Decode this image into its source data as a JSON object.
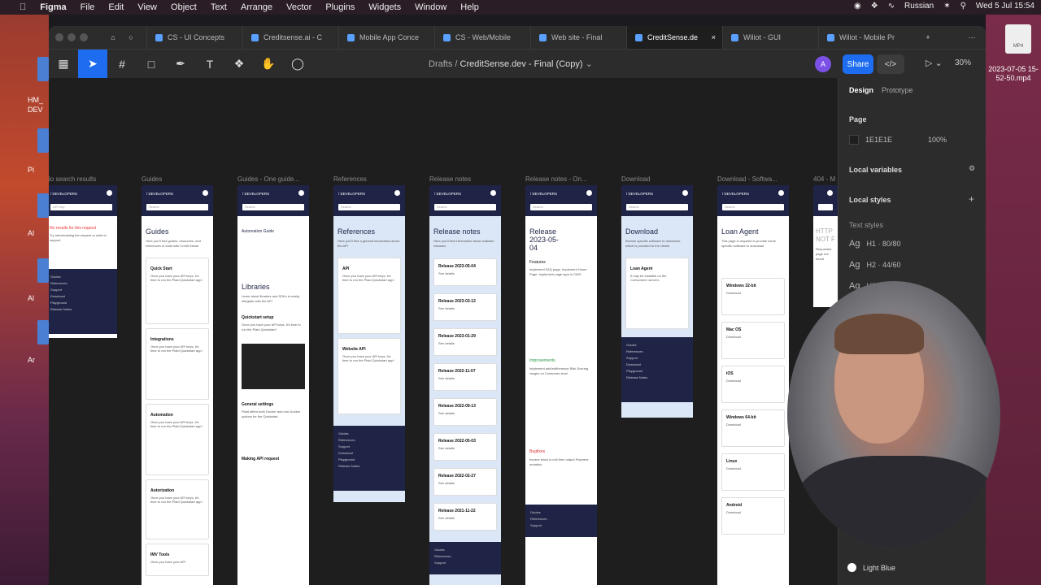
{
  "menubar": {
    "app": "Figma",
    "items": [
      "File",
      "Edit",
      "View",
      "Object",
      "Text",
      "Arrange",
      "Vector",
      "Plugins",
      "Widgets",
      "Window",
      "Help"
    ],
    "input_source": "Russian",
    "datetime": "Wed 5 Jul  15:54"
  },
  "desktop": {
    "left_labels": [
      "HM_",
      "DEV",
      "Pi",
      "Al",
      "Al",
      "Ar"
    ],
    "file_name": "2023-07-05 15-52-50.mp4",
    "file_badge": "MP4"
  },
  "tabs": [
    {
      "label": "CS - UI Concepts",
      "active": false
    },
    {
      "label": "Creditsense.ai - C",
      "active": false
    },
    {
      "label": "Mobile App Conce",
      "active": false
    },
    {
      "label": "CS - Web/Mobile",
      "active": false
    },
    {
      "label": "Web site - Final",
      "active": false
    },
    {
      "label": "CreditSense.de",
      "active": true
    },
    {
      "label": "Wiliot - GUI",
      "active": false
    },
    {
      "label": "Wiliot - Mobile Pr",
      "active": false
    }
  ],
  "toolbar": {
    "breadcrumb_root": "Drafts",
    "file_title": "CreditSense.dev - Final (Copy)",
    "avatar_initial": "A",
    "share_label": "Share",
    "dev_label": "</>",
    "zoom": "30%"
  },
  "frames": [
    {
      "label": "No search results",
      "title": "",
      "search": "API Key",
      "body": "No results for this request",
      "desc": "Try reformulating the request or write to support",
      "cards": [],
      "footer": [
        "Guides",
        "References",
        "Support",
        "Download",
        "Playground",
        "Release Notes"
      ]
    },
    {
      "label": "Guides",
      "title": "Guides",
      "search": "Search",
      "body": "",
      "desc": "Here you'll find guides, resources, and references to build with Credit Sense",
      "cards": [
        {
          "t": "Quick Start",
          "d": "Once you have your API keys, it's time to run the Plaid Quickstart app!"
        },
        {
          "t": "Integrations",
          "d": "Once you have your API keys, it's time to run the Plaid Quickstart app!"
        },
        {
          "t": "Automation",
          "d": "Once you have your API keys, it's time to run the Plaid Quickstart app!"
        },
        {
          "t": "Autorization",
          "d": "Once you have your API keys, it's time to run the Plaid Quickstart app!"
        },
        {
          "t": "IMV Tools",
          "d": "Once you have your API"
        }
      ],
      "footer": []
    },
    {
      "label": "Guides - One guide...",
      "title": "",
      "search": "Search",
      "body": "Automation Guide",
      "desc": "",
      "cards": [
        {
          "t": "Libraries",
          "d": "Learn about libraries and SDKs to easily integrate with the API"
        },
        {
          "t": "Quickstart setup",
          "d": "Once you have your API keys, it's time to run the Plaid Quickstart!"
        },
        {
          "t": "General settings",
          "d": "Plaid offers both Docker and non-Docker options for the Quickstart."
        },
        {
          "t": "Making API request",
          "d": ""
        }
      ],
      "footer": []
    },
    {
      "label": "References",
      "title": "References",
      "search": "Search",
      "body": "",
      "desc": "Here you'll find a general information about the API",
      "cards": [
        {
          "t": "API",
          "d": "Once you have your API keys, it's time to run the Plaid Quickstart app!"
        },
        {
          "t": "Website API",
          "d": "Once you have your API keys, it's time to run the Plaid Quickstart app!"
        }
      ],
      "footer": [
        "Guides",
        "References",
        "Support",
        "Download",
        "Playground",
        "Release Notes"
      ]
    },
    {
      "label": "Release notes",
      "title": "Release notes",
      "search": "Search",
      "body": "",
      "desc": "Here you'll find information about software releases",
      "cards": [
        {
          "t": "Release 2023-05-04",
          "d": "See details"
        },
        {
          "t": "Release 2023-03-12",
          "d": "See details"
        },
        {
          "t": "Release 2023-01-29",
          "d": "See details"
        },
        {
          "t": "Release 2022-11-07",
          "d": "See details"
        },
        {
          "t": "Release 2022-09-13",
          "d": "See details"
        },
        {
          "t": "Release 2022-05-03",
          "d": "See details"
        },
        {
          "t": "Release 2022-02-27",
          "d": "See details"
        },
        {
          "t": "Release 2021-11-22",
          "d": "See details"
        }
      ],
      "footer": [
        "Guides",
        "References",
        "Support"
      ]
    },
    {
      "label": "Release notes - On...",
      "title": "Release 2023-05-04",
      "search": "Search",
      "body": "Features",
      "desc": "Implement FAQ page. Implement Home Page. Implement page type in CMS.",
      "cards": [
        {
          "t": "Improvements",
          "d": "Implement add/edit/remove Risk Scoring ranges on Consumer-level"
        },
        {
          "t": "Bugfixes",
          "d": "Invoice block is null then output Payment mutation"
        }
      ],
      "footer": [
        "Guides",
        "References",
        "Support"
      ]
    },
    {
      "label": "Download",
      "title": "Download",
      "search": "Search",
      "body": "",
      "desc": "Browse specific software to download, which is provided to the clients",
      "cards": [
        {
          "t": "Loan Agent",
          "d": "It may be installed on the Consumers' servers"
        }
      ],
      "footer": [
        "Guides",
        "References",
        "Support",
        "Download",
        "Playground",
        "Release Notes"
      ]
    },
    {
      "label": "Download - Softwa...",
      "title": "Loan Agent",
      "search": "Search",
      "body": "",
      "desc": "This page is required to provide some specific software to download",
      "cards": [
        {
          "t": "Windows 32-bit",
          "d": "Download"
        },
        {
          "t": "Mac OS",
          "d": "Download"
        },
        {
          "t": "iOS",
          "d": "Download"
        },
        {
          "t": "Windows 64-bit",
          "d": "Download"
        },
        {
          "t": "Linux",
          "d": "Download"
        },
        {
          "t": "Android",
          "d": "Download"
        }
      ],
      "footer": []
    },
    {
      "label": "404 - M",
      "title": "HTTP NOT F",
      "search": "",
      "body": "",
      "desc": "Requested page not found",
      "cards": [],
      "footer": []
    }
  ],
  "panel": {
    "tab_design": "Design",
    "tab_prototype": "Prototype",
    "page_section": "Page",
    "page_color": "1E1E1E",
    "page_opacity": "100%",
    "local_variables": "Local variables",
    "local_styles": "Local styles",
    "text_styles": "Text styles",
    "styles": [
      {
        "sample": "Ag",
        "name": "H1 · 80/80"
      },
      {
        "sample": "Ag",
        "name": "H2 · 44/60"
      },
      {
        "sample": "Ag",
        "name": "H3"
      }
    ],
    "color_label": "Light Blue"
  }
}
